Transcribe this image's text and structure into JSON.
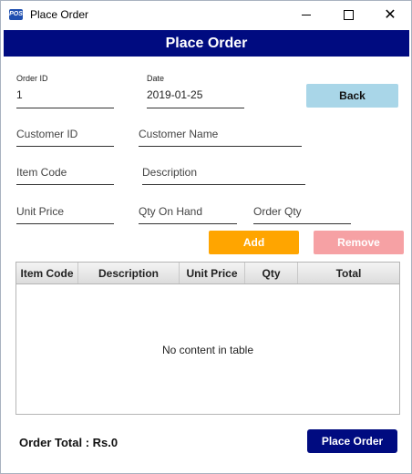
{
  "window": {
    "title": "Place Order",
    "app_icon_text": "POS",
    "minimize_symbol": "",
    "close_symbol": "✕"
  },
  "header": {
    "title": "Place Order"
  },
  "order_id": {
    "label": "Order ID",
    "value": "1"
  },
  "date": {
    "label": "Date",
    "value": "2019-01-25"
  },
  "buttons": {
    "back": "Back",
    "add": "Add",
    "remove": "Remove",
    "place_order": "Place Order"
  },
  "fields": {
    "customer_id": "Customer ID",
    "customer_name": "Customer Name",
    "item_code": "Item Code",
    "description": "Description",
    "unit_price": "Unit Price",
    "qty_on_hand": "Qty On Hand",
    "order_qty": "Order Qty"
  },
  "table": {
    "columns": [
      "Item Code",
      "Description",
      "Unit Price",
      "Qty",
      "Total"
    ],
    "empty_message": "No content in table"
  },
  "order_total": "Order Total : Rs.0",
  "colors": {
    "header_bg": "#000b80",
    "back_bg": "#a9d6e8",
    "add_bg": "#ffa500",
    "remove_bg": "#f6a1a4",
    "place_order_bg": "#000b80"
  }
}
